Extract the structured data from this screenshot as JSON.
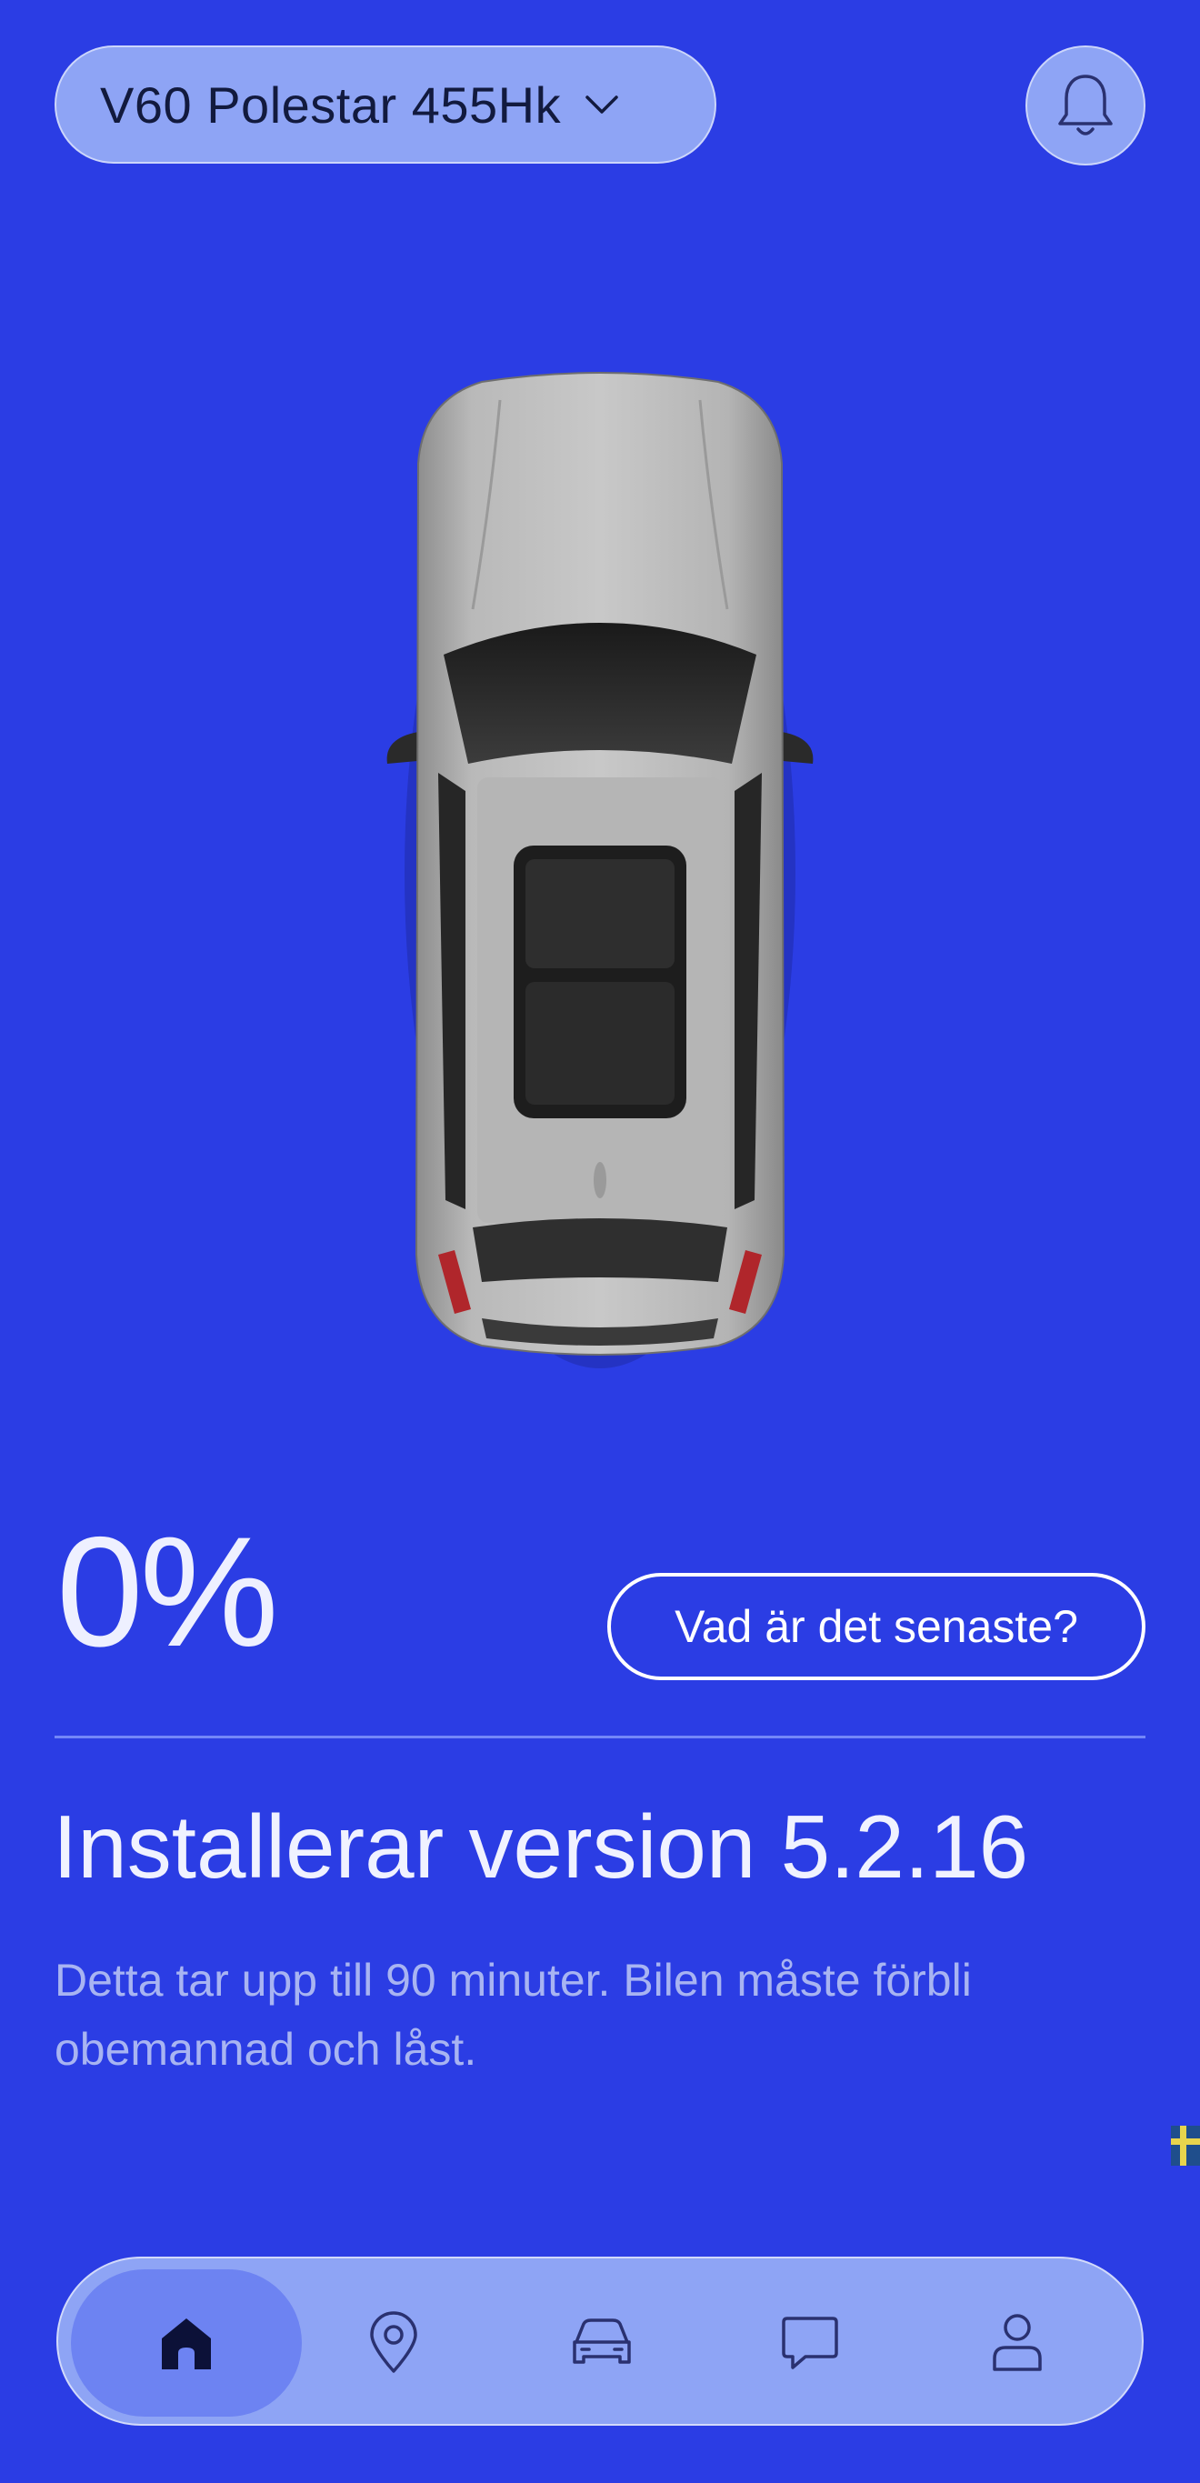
{
  "header": {
    "vehicle_name": "V60 Polestar 455Hk"
  },
  "status": {
    "percent": "0%",
    "whats_new_label": "Vad är det senaste?",
    "title": "Installerar version 5.2.16",
    "description": "Detta tar upp till 90 minuter. Bilen måste förbli obemannad och låst."
  },
  "nav": {
    "items": [
      {
        "icon": "home-icon",
        "active": true
      },
      {
        "icon": "location-pin-icon",
        "active": false
      },
      {
        "icon": "car-icon",
        "active": false
      },
      {
        "icon": "chat-icon",
        "active": false
      },
      {
        "icon": "profile-icon",
        "active": false
      }
    ]
  },
  "colors": {
    "background": "#2b3de4",
    "pill": "#8ea4f5",
    "active_nav": "#6d83f2",
    "text_light": "#f0f2ff",
    "text_muted": "#a8b4f2"
  }
}
